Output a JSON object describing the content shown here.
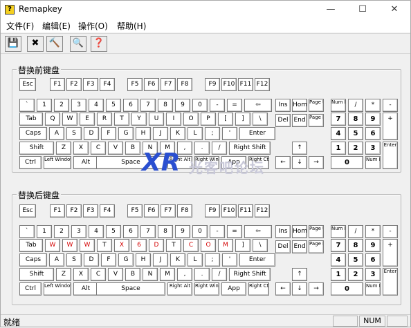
{
  "window": {
    "title": "Remapkey",
    "min": "—",
    "max": "☐",
    "close": "✕"
  },
  "menu": [
    "文件(F)",
    "编辑(E)",
    "操作(O)",
    "帮助(H)"
  ],
  "toolbar": [
    "💾",
    "✖",
    "🔨",
    "🔍",
    "❓"
  ],
  "before_title": "替换前键盘",
  "after_title": "替换后键盘",
  "watermark": "光客吧论坛",
  "watermark_logo": "XR",
  "status": {
    "text": "就绪",
    "num": "NUM"
  },
  "before": {
    "esc": "Esc",
    "f": [
      "F1",
      "F2",
      "F3",
      "F4",
      "F5",
      "F6",
      "F7",
      "F8",
      "F9",
      "F10",
      "F11",
      "F12"
    ],
    "row1": [
      "`",
      "1",
      "2",
      "3",
      "4",
      "5",
      "6",
      "7",
      "8",
      "9",
      "0",
      "-",
      "=",
      "⇦"
    ],
    "row2": [
      "Tab",
      "Q",
      "W",
      "E",
      "R",
      "T",
      "Y",
      "U",
      "I",
      "O",
      "P",
      "[",
      "]",
      "\\"
    ],
    "row3": [
      "Caps",
      "A",
      "S",
      "D",
      "F",
      "G",
      "H",
      "J",
      "K",
      "L",
      ";",
      "'",
      "Enter"
    ],
    "row4": [
      "Shift",
      "Z",
      "X",
      "C",
      "V",
      "B",
      "N",
      "M",
      ",",
      ".",
      "/",
      "Right Shift"
    ],
    "row5": [
      "Ctrl",
      "Left Windows",
      "Alt",
      "Space",
      "Right Alt",
      "Right Windows",
      "App",
      "Right Ctrl"
    ],
    "nav": [
      "Ins",
      "Home",
      "Page Up",
      "Del",
      "End",
      "Page Down",
      "↑",
      "←",
      "↓",
      "→"
    ],
    "num": [
      "Num Lock",
      "/",
      "*",
      "-",
      "7",
      "8",
      "9",
      "+",
      "4",
      "5",
      "6",
      "1",
      "2",
      "3",
      "Enter",
      "0",
      "Num Del"
    ]
  },
  "after": {
    "esc": "Esc",
    "f": [
      "F1",
      "F2",
      "F3",
      "F4",
      "F5",
      "F6",
      "F7",
      "F8",
      "F9",
      "F10",
      "F11",
      "F12"
    ],
    "row1": [
      "`",
      "1",
      "2",
      "3",
      "4",
      "5",
      "6",
      "7",
      "8",
      "9",
      "0",
      "-",
      "=",
      "⇦"
    ],
    "row2": [
      "Tab",
      "W",
      "W",
      "W",
      "T",
      "X",
      "6",
      "D",
      "T",
      "C",
      "O",
      "M",
      "]",
      "\\"
    ],
    "row3": [
      "Caps",
      "A",
      "S",
      "D",
      "F",
      "G",
      "H",
      "J",
      "K",
      "L",
      ";",
      "'",
      "Enter"
    ],
    "row4": [
      "Shift",
      "Z",
      "X",
      "C",
      "V",
      "B",
      "N",
      "M",
      ",",
      ".",
      "/",
      "Right Shift"
    ],
    "row5": [
      "Ctrl",
      "Left Windows",
      "Alt",
      "Space",
      "Right Alt",
      "Right Windows",
      "App",
      "Right Ctrl"
    ],
    "nav": [
      "Ins",
      "Home",
      "Page Up",
      "Del",
      "End",
      "Page Down",
      "↑",
      "←",
      "↓",
      "→"
    ],
    "num": [
      "Num Lock",
      "/",
      "*",
      "-",
      "7",
      "8",
      "9",
      "+",
      "4",
      "5",
      "6",
      "1",
      "2",
      "3",
      "Enter",
      "0",
      "Num Del"
    ]
  }
}
